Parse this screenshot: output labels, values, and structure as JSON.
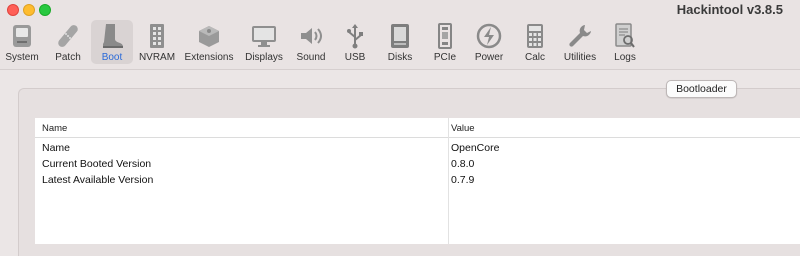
{
  "app_title": "Hackintool v3.8.5",
  "toolbar": {
    "items": [
      {
        "label": "System",
        "icon": "system-icon"
      },
      {
        "label": "Patch",
        "icon": "patch-icon"
      },
      {
        "label": "Boot",
        "icon": "boot-icon",
        "selected": true
      },
      {
        "label": "NVRAM",
        "icon": "nvram-icon"
      },
      {
        "label": "Extensions",
        "icon": "extensions-icon"
      },
      {
        "label": "Displays",
        "icon": "displays-icon"
      },
      {
        "label": "Sound",
        "icon": "sound-icon"
      },
      {
        "label": "USB",
        "icon": "usb-icon"
      },
      {
        "label": "Disks",
        "icon": "disks-icon"
      },
      {
        "label": "PCIe",
        "icon": "pcie-icon"
      },
      {
        "label": "Power",
        "icon": "power-icon"
      },
      {
        "label": "Calc",
        "icon": "calc-icon"
      },
      {
        "label": "Utilities",
        "icon": "utilities-icon"
      },
      {
        "label": "Logs",
        "icon": "logs-icon"
      }
    ]
  },
  "segment": {
    "label": "Bootloader"
  },
  "table": {
    "columns": [
      "Name",
      "Value"
    ],
    "rows": [
      {
        "name": "Name",
        "value": "OpenCore"
      },
      {
        "name": "Current Booted Version",
        "value": "0.8.0"
      },
      {
        "name": "Latest Available Version",
        "value": "0.7.9"
      }
    ]
  },
  "colors": {
    "accent": "#2a6ad8",
    "window_bg": "#ebe6e6"
  }
}
